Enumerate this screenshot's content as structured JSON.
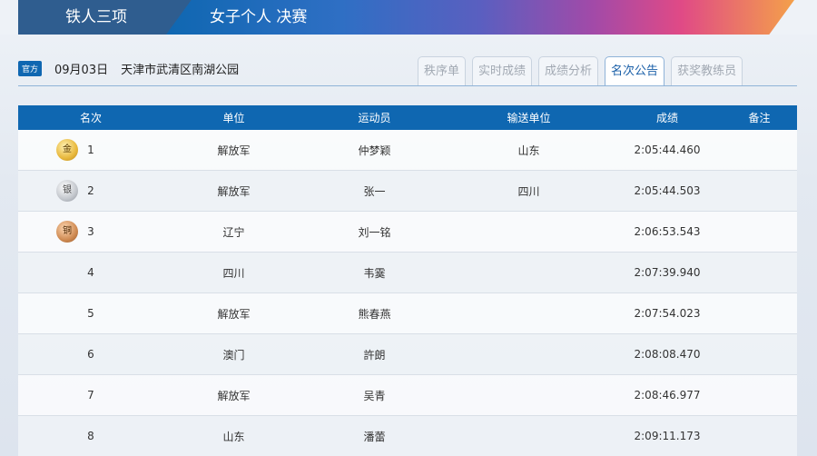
{
  "banner": {
    "sport": "铁人三项",
    "event": "女子个人 决赛"
  },
  "info": {
    "badge": "官方",
    "date": "09月03日",
    "venue": "天津市武清区南湖公园"
  },
  "tabs": [
    {
      "label": "秩序单",
      "active": false
    },
    {
      "label": "实时成绩",
      "active": false
    },
    {
      "label": "成绩分析",
      "active": false
    },
    {
      "label": "名次公告",
      "active": true
    },
    {
      "label": "获奖教练员",
      "active": false
    }
  ],
  "table": {
    "headers": [
      "名次",
      "单位",
      "运动员",
      "输送单位",
      "成绩",
      "备注"
    ],
    "rows": [
      {
        "rank": "1",
        "medal": "金",
        "medal_type": "gold",
        "unit": "解放军",
        "athlete": "仲梦颖",
        "sending_unit": "山东",
        "result": "2:05:44.460",
        "note": ""
      },
      {
        "rank": "2",
        "medal": "银",
        "medal_type": "silver",
        "unit": "解放军",
        "athlete": "张一",
        "sending_unit": "四川",
        "result": "2:05:44.503",
        "note": ""
      },
      {
        "rank": "3",
        "medal": "铜",
        "medal_type": "bronze",
        "unit": "辽宁",
        "athlete": "刘一铭",
        "sending_unit": "",
        "result": "2:06:53.543",
        "note": ""
      },
      {
        "rank": "4",
        "medal": "",
        "medal_type": "",
        "unit": "四川",
        "athlete": "韦霙",
        "sending_unit": "",
        "result": "2:07:39.940",
        "note": ""
      },
      {
        "rank": "5",
        "medal": "",
        "medal_type": "",
        "unit": "解放军",
        "athlete": "熊春燕",
        "sending_unit": "",
        "result": "2:07:54.023",
        "note": ""
      },
      {
        "rank": "6",
        "medal": "",
        "medal_type": "",
        "unit": "澳门",
        "athlete": "許朗",
        "sending_unit": "",
        "result": "2:08:08.470",
        "note": ""
      },
      {
        "rank": "7",
        "medal": "",
        "medal_type": "",
        "unit": "解放军",
        "athlete": "吴青",
        "sending_unit": "",
        "result": "2:08:46.977",
        "note": ""
      },
      {
        "rank": "8",
        "medal": "",
        "medal_type": "",
        "unit": "山东",
        "athlete": "潘蕾",
        "sending_unit": "",
        "result": "2:09:11.173",
        "note": ""
      }
    ]
  }
}
